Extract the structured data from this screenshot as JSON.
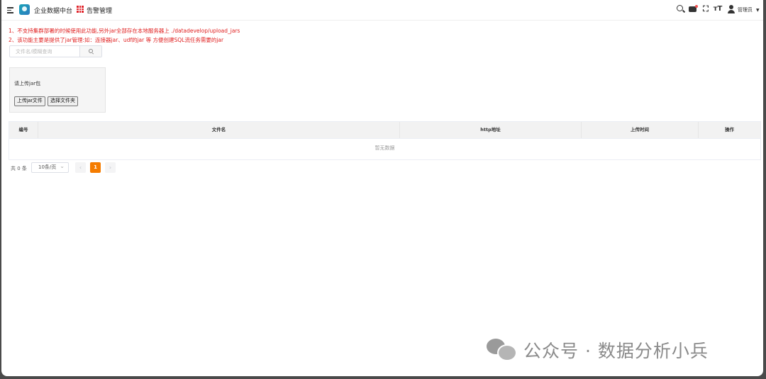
{
  "header": {
    "app_title": "企业数据中台",
    "module": "告警管理",
    "user_name": "管理员",
    "icons": [
      "menu-icon",
      "app-logo",
      "apps-grid-icon",
      "search-icon",
      "message-icon",
      "fullscreen-icon",
      "font-size-icon",
      "user-icon"
    ],
    "colors": {
      "module_icon": "#e0242b",
      "notice": "#e02020",
      "accent": "#f57c00"
    }
  },
  "notices": [
    "1、不支持集群部署的时候使用此功能,另外jar全部存在本地服务器上 ./datadevelop/upload_jars",
    "2、该功能主要是提供了jar管理:如：连接器jar、udf的jar 等 方便创建SQL流任务需要的jar"
  ],
  "search": {
    "placeholder": "文件名/模糊查询",
    "value": ""
  },
  "upload": {
    "label": "请上传jar包",
    "upload_file_button": "上传jar文件",
    "select_folder_button": "选择文件夹"
  },
  "table": {
    "columns": [
      "编号",
      "文件名",
      "http地址",
      "上传时间",
      "操作"
    ],
    "rows": [],
    "empty_text": "暂无数据"
  },
  "pagination": {
    "total_text": "共 0 条",
    "page_size": "10条/页",
    "current_page": "1",
    "prev": "‹",
    "next": "›"
  },
  "watermark": {
    "text": "公众号 · 数据分析小兵"
  }
}
